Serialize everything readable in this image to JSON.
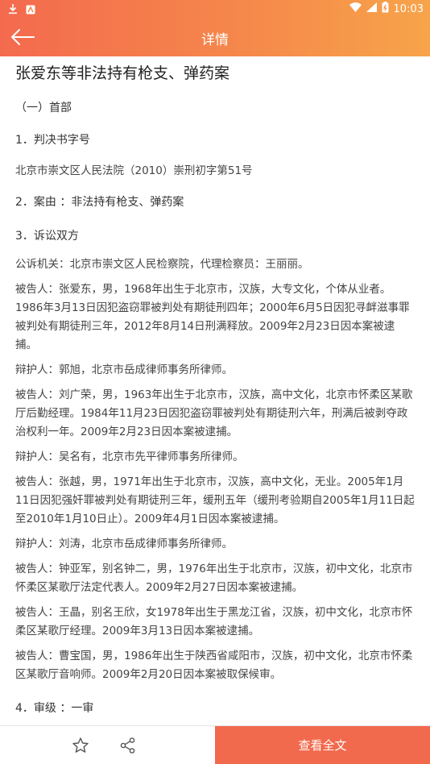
{
  "status_bar": {
    "time": "10:03"
  },
  "header": {
    "title": "详情"
  },
  "document": {
    "title": "张爱东等非法持有枪支、弹药案",
    "section_head": "（一）首部",
    "h1": "1．判决书字号",
    "case_number": "北京市崇文区人民法院（2010）崇刑初字第51号",
    "h2": "2．案由 ：非法持有枪支、弹药案",
    "h3": "3．诉讼双方",
    "prosecutor": "公诉机关：北京市崇文区人民检察院，代理检察员：王丽丽。",
    "defendant1": "被告人：张爱东，男，1968年出生于北京市，汉族，大专文化，个体从业者。1986年3月13日因犯盗窃罪被判处有期徒刑四年；2000年6月5日因犯寻衅滋事罪被判处有期徒刑三年，2012年8月14日刑满释放。2009年2月23日因本案被逮捕。",
    "defender1": "辩护人：郭旭，北京市岳成律师事务所律师。",
    "defendant2": "被告人：刘广荣，男，1963年出生于北京市，汉族，高中文化，北京市怀柔区某歌厅后勤经理。1984年11月23日因犯盗窃罪被判处有期徒刑六年，刑满后被剥夺政治权利一年。2009年2月23日因本案被逮捕。",
    "defender2": "辩护人：吴名有，北京市先平律师事务所律师。",
    "defendant3": "被告人：张越，男，1971年出生于北京市，汉族，高中文化，无业。2005年1月11日因犯强奸罪被判处有期徒刑三年，缓刑五年（缓刑考验期自2005年1月11日起至2010年1月10日止）。2009年4月1日因本案被逮捕。",
    "defender3": "辩护人：刘涛，北京市岳成律师事务所律师。",
    "defendant4": "被告人：钟亚军，别名钟二，男，1976年出生于北京市，汉族，初中文化，北京市怀柔区某歌厅法定代表人。2009年2月27日因本案被逮捕。",
    "defendant5": "被告人：王晶，别名王欣，女1978年出生于黑龙江省，汉族，初中文化，北京市怀柔区某歌厅经理。2009年3月13日因本案被逮捕。",
    "defendant6": "被告人：曹宝国，男，1986年出生于陕西省咸阳市，汉族，初中文化，北京市怀柔区某歌厅音响师。2009年2月20日因本案被取保候审。",
    "h4": "4．审级 ：一审"
  },
  "bottom_bar": {
    "fulltext_label": "查看全文"
  },
  "colors": {
    "accent": "#f26a4d",
    "gradient_start": "#f46a4e",
    "gradient_end": "#f7a44a"
  }
}
